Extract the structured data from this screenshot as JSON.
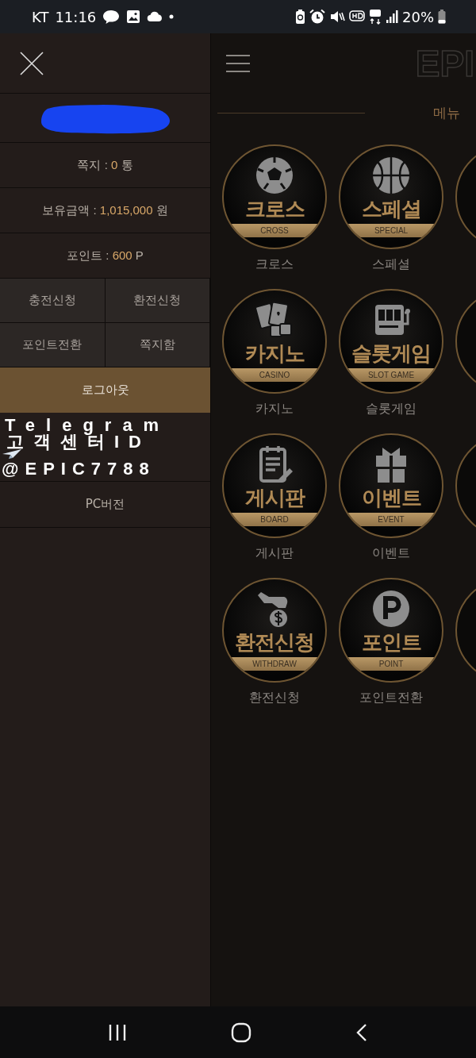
{
  "status_bar": {
    "carrier": "KT",
    "time": "11:16",
    "battery": "20%"
  },
  "sidebar": {
    "info_rows": [
      {
        "label": "쪽지 : ",
        "value": "0",
        "unit": " 통"
      },
      {
        "label": "보유금액 : ",
        "value": "1,015,000",
        "unit": " 원"
      },
      {
        "label": "포인트 : ",
        "value": "600",
        "unit": " P"
      }
    ],
    "actions": [
      "충전신청",
      "환전신청",
      "포인트전환",
      "쪽지함"
    ],
    "logout": "로그아웃",
    "telegram_lines": [
      "Telegram",
      "고객센터ID",
      "@EPIC7788"
    ],
    "pc_version": "PC버전"
  },
  "main": {
    "logo": "EPI",
    "section_title": "메뉴",
    "menu_items": [
      {
        "kind": "soccer",
        "title": "크로스",
        "subtitle": "CROSS",
        "label": "크로스"
      },
      {
        "kind": "basketball",
        "title": "스페셜",
        "subtitle": "SPECIAL",
        "label": "스페셜"
      },
      {
        "kind": "cards",
        "title": "카지노",
        "subtitle": "CASINO",
        "label": "카지노"
      },
      {
        "kind": "slot",
        "title": "슬롯게임",
        "subtitle": "SLOT GAME",
        "label": "슬롯게임"
      },
      {
        "kind": "board",
        "title": "게시판",
        "subtitle": "BOARD",
        "label": "게시판"
      },
      {
        "kind": "gift",
        "title": "이벤트",
        "subtitle": "EVENT",
        "label": "이벤트"
      },
      {
        "kind": "coin",
        "title": "환전신청",
        "subtitle": "WITHDRAW",
        "label": "환전신청"
      },
      {
        "kind": "point",
        "title": "포인트",
        "subtitle": "POINT",
        "label": "포인트전환"
      }
    ]
  }
}
